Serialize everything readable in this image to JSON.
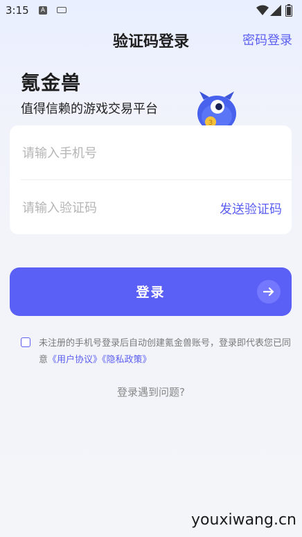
{
  "status_bar": {
    "time": "3:15",
    "app_icon_letter": "A"
  },
  "header": {
    "title": "验证码登录",
    "switch_link": "密码登录"
  },
  "brand": {
    "name": "氪金兽",
    "slogan": "值得信赖的游戏交易平台"
  },
  "form": {
    "phone_placeholder": "请输入手机号",
    "code_placeholder": "请输入验证码",
    "send_code_label": "发送验证码"
  },
  "login_button": {
    "label": "登录"
  },
  "agreement": {
    "prefix": "未注册的手机号登录后自动创建氪金兽账号，登录即代表您已同意",
    "user_agreement": "《用户协议》",
    "privacy_policy": "《隐私政策》"
  },
  "help_link": "登录遇到问题?",
  "watermark": "youxiwang.cn",
  "colors": {
    "accent": "#5a5ff5",
    "link": "#5b5ef0",
    "placeholder": "#b5b5b5",
    "card": "#ffffff"
  },
  "icons": [
    "wifi-icon",
    "signal-icon",
    "battery-icon",
    "arrow-right-icon",
    "mascot-icon"
  ]
}
